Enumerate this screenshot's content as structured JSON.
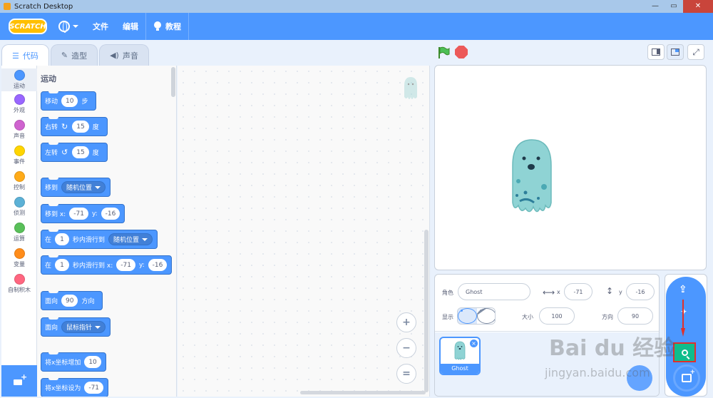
{
  "window": {
    "title": "Scratch Desktop",
    "controls": {
      "minimize": "—",
      "maximize": "▭",
      "close": "✕"
    }
  },
  "menubar": {
    "logo": "SCRATCH",
    "file": "文件",
    "edit": "编辑",
    "tutorials": "教程"
  },
  "tabs": [
    {
      "label": "代码",
      "active": true
    },
    {
      "label": "造型",
      "active": false
    },
    {
      "label": "声音",
      "active": false
    }
  ],
  "categories": [
    {
      "label": "运动",
      "color": "#4c97ff"
    },
    {
      "label": "外观",
      "color": "#9966ff"
    },
    {
      "label": "声音",
      "color": "#cf63cf"
    },
    {
      "label": "事件",
      "color": "#ffd500"
    },
    {
      "label": "控制",
      "color": "#ffab19"
    },
    {
      "label": "侦测",
      "color": "#5cb1d6"
    },
    {
      "label": "运算",
      "color": "#59c059"
    },
    {
      "label": "变量",
      "color": "#ff8c1a"
    },
    {
      "label": "自制积木",
      "color": "#ff6680"
    }
  ],
  "palette": {
    "section_title": "运动",
    "move": {
      "pre": "移动",
      "steps": "10",
      "post": "步"
    },
    "turn_right": {
      "pre": "右转",
      "deg": "15",
      "post": "度"
    },
    "turn_left": {
      "pre": "左转",
      "deg": "15",
      "post": "度"
    },
    "goto": {
      "pre": "移到",
      "target": "随机位置"
    },
    "goto_xy": {
      "pre": "移到 x:",
      "x": "-71",
      "ylabel": "y:",
      "y": "-16"
    },
    "glide_to": {
      "pre": "在",
      "secs": "1",
      "mid": "秒内滑行到",
      "target": "随机位置"
    },
    "glide_xy": {
      "pre": "在",
      "secs": "1",
      "mid": "秒内滑行到 x:",
      "x": "-71",
      "ylabel": "y:",
      "y": "-16"
    },
    "point_dir": {
      "pre": "面向",
      "dir": "90",
      "post": "方向"
    },
    "point_towards": {
      "pre": "面向",
      "target": "鼠标指针"
    },
    "change_x": {
      "pre": "将x坐标增加",
      "val": "10"
    },
    "set_x": {
      "pre": "将x坐标设为",
      "val": "-71"
    }
  },
  "code_area": {
    "zoom_in": "+",
    "zoom_out": "−",
    "zoom_reset": "="
  },
  "sprite_info": {
    "sprite_label": "角色",
    "sprite_name": "Ghost",
    "x_label": "x",
    "x": "-71",
    "y_label": "y",
    "y": "-16",
    "show_label": "显示",
    "size_label": "大小",
    "size": "100",
    "direction_label": "方向",
    "direction": "90"
  },
  "sprites": [
    {
      "name": "Ghost",
      "delete": "×"
    }
  ],
  "colors": {
    "accent": "#4c97ff",
    "menubar": "#4c97ff",
    "search_button": "#0fbd8c",
    "highlight_box": "#e0302a"
  },
  "watermark": {
    "brand": "Bai du 经验",
    "url": "jingyan.baidu.com"
  }
}
